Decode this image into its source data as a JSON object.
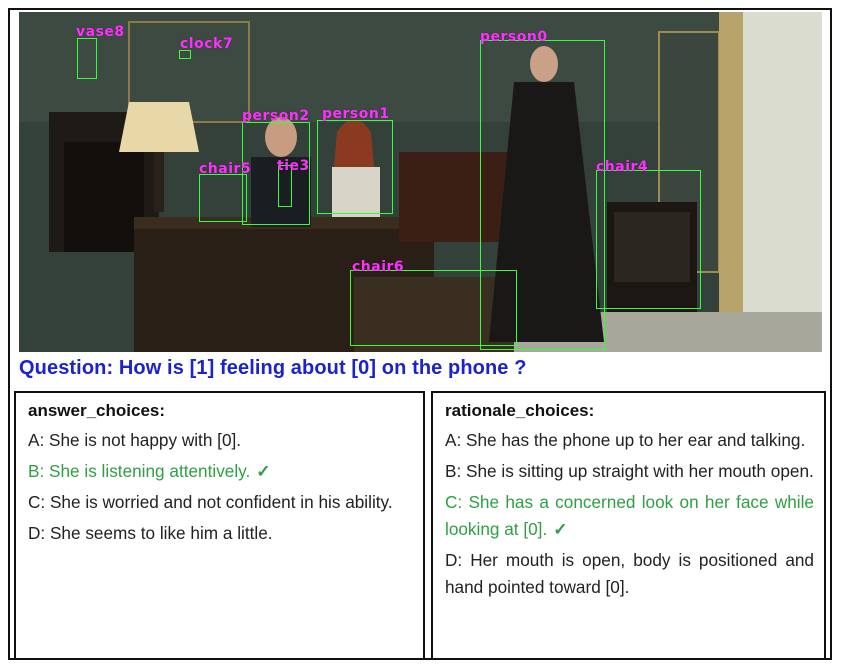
{
  "question": "Question: How is [1] feeling about [0] on the phone ?",
  "objects": [
    {
      "label": "vase8"
    },
    {
      "label": "clock7"
    },
    {
      "label": "person0"
    },
    {
      "label": "person2"
    },
    {
      "label": "person1"
    },
    {
      "label": "chair5"
    },
    {
      "label": "tie3"
    },
    {
      "label": "chair4"
    },
    {
      "label": "chair6"
    }
  ],
  "answer_panel": {
    "title": "answer_choices:",
    "choices": [
      {
        "text": "A: She is not happy with [0].",
        "correct": false
      },
      {
        "text": "B: She is listening attentively.",
        "correct": true
      },
      {
        "text": "C: She is worried and not confident in his ability.",
        "correct": false
      },
      {
        "text": "D: She seems to like him a little.",
        "correct": false
      }
    ]
  },
  "rationale_panel": {
    "title": "rationale_choices:",
    "choices": [
      {
        "text": "A: She has the phone up to her ear and talking.",
        "correct": false
      },
      {
        "text": "B: She is sitting up straight with her mouth open.",
        "correct": false
      },
      {
        "text": "C: She has a concerned look on her face while looking at [0].",
        "correct": true
      },
      {
        "text": "D: Her mouth is open, body is positioned and hand pointed toward [0].",
        "correct": false
      }
    ]
  },
  "check_mark": "✓",
  "colors": {
    "box": "#35ff3c",
    "label": "#ff30ff",
    "question": "#1b23d0",
    "correct": "#2ea043"
  }
}
